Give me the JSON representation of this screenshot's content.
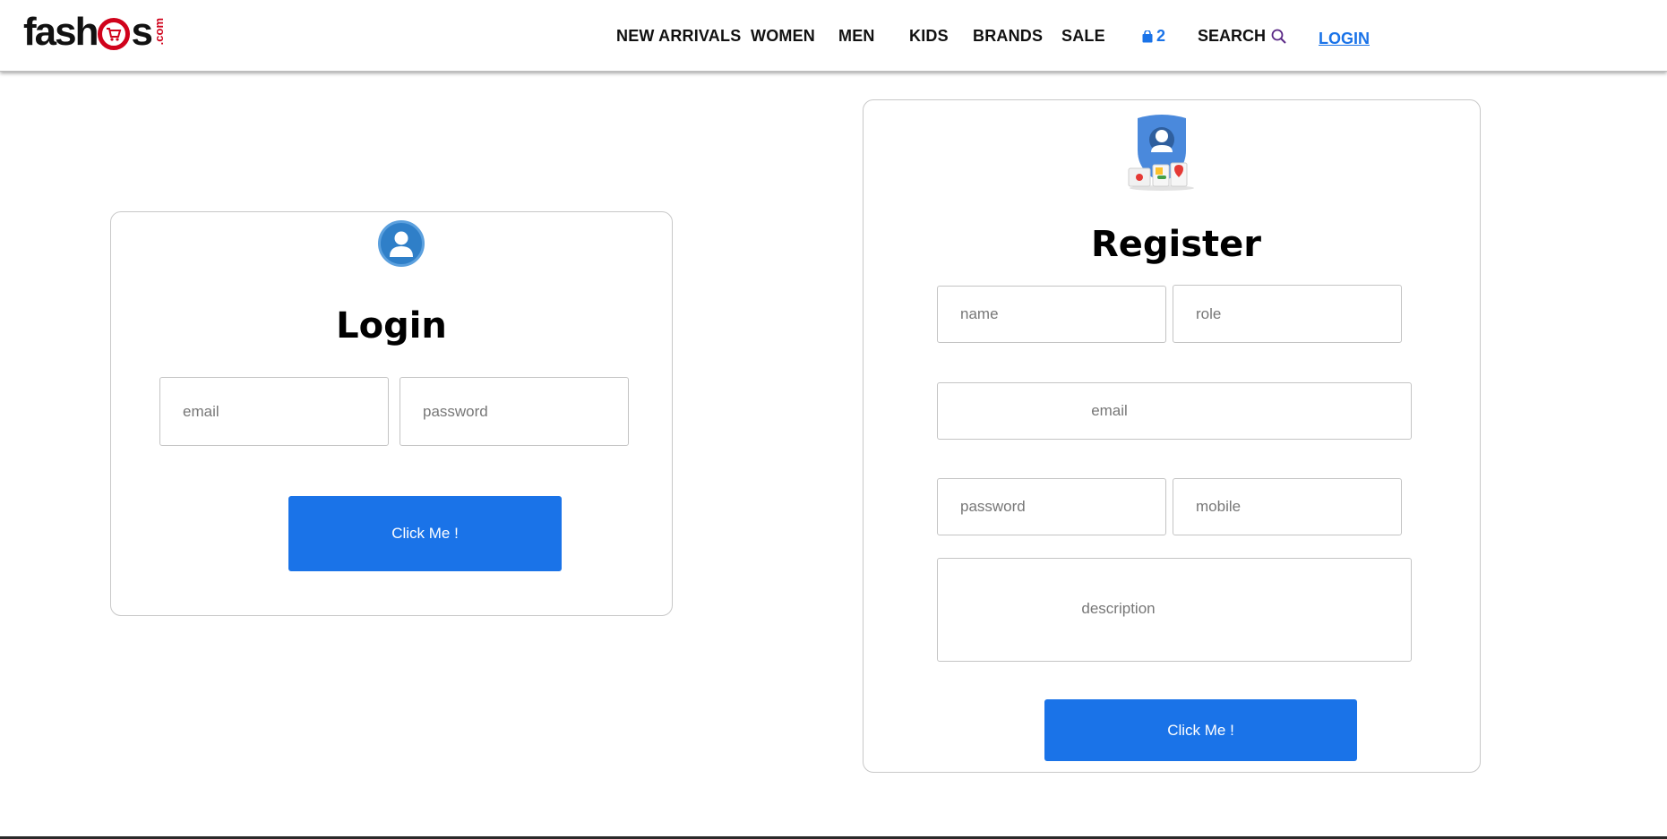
{
  "brand": {
    "name_part1": "fash",
    "name_part2": "s",
    "suffix": ".com"
  },
  "nav": {
    "items": [
      {
        "label": "NEW ARRIVALS"
      },
      {
        "label": "WOMEN"
      },
      {
        "label": "MEN"
      },
      {
        "label": "KIDS"
      },
      {
        "label": "BRANDS"
      },
      {
        "label": "SALE"
      }
    ],
    "cart_count": "2",
    "search_label": "SEARCH",
    "login_label": "LOGIN"
  },
  "login": {
    "title": "Login",
    "email_placeholder": "email",
    "password_placeholder": "password",
    "submit_label": "Click Me !"
  },
  "register": {
    "title": "Register",
    "name_placeholder": "name",
    "role_placeholder": "role",
    "email_placeholder": "email",
    "password_placeholder": "password",
    "mobile_placeholder": "mobile",
    "description_placeholder": "description",
    "submit_label": "Click Me !"
  },
  "colors": {
    "accent": "#1a73e8",
    "brand_red": "#d0021b",
    "avatar_blue": "#2f7fc8"
  },
  "icons": {
    "cart": "shopping-bag-icon",
    "search": "search-icon",
    "login_avatar": "user-avatar-icon",
    "register_shield": "account-shield-icon"
  }
}
